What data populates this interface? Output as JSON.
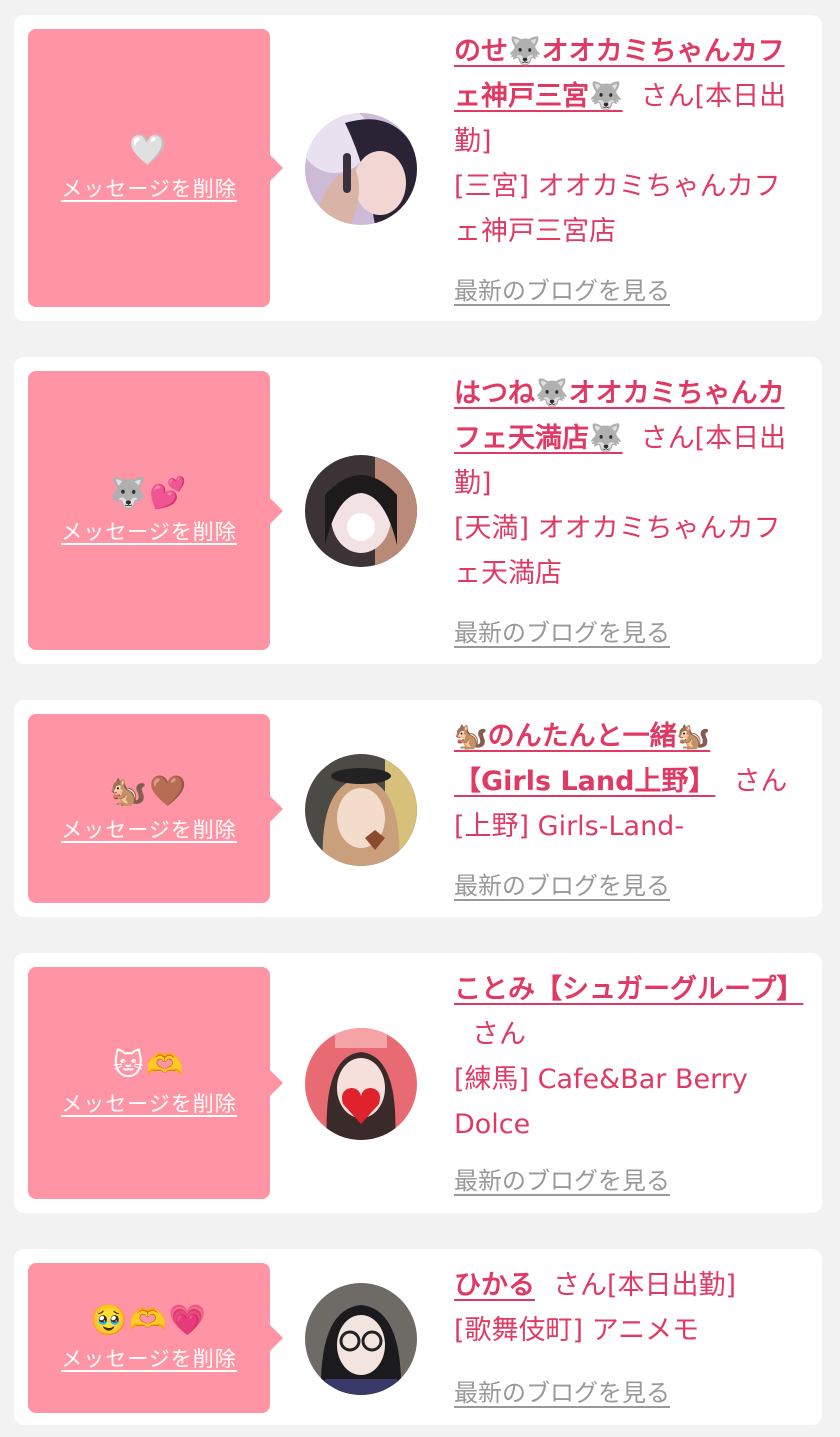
{
  "common": {
    "delete_label": "メッセージを削除",
    "blog_label": "最新のブログを見る",
    "honorific": "さん"
  },
  "colors": {
    "page_background": "#f2f2f2",
    "card_background": "#ffffff",
    "bubble_pink": "#ff94a4",
    "accent_text": "#e03a64",
    "muted_link": "#999999"
  },
  "messages": [
    {
      "stamp": "🤍",
      "cast_name": "のせ🐺オオカミちゃんカフェ神戸三宮🐺",
      "status": "[本日出勤]",
      "shop": "[三宮] オオカミちゃんカフェ神戸三宮店",
      "avatar_icon": "cast-photo"
    },
    {
      "stamp": "🐺💕",
      "cast_name": "はつね🐺オオカミちゃんカフェ天満店🐺",
      "status": "[本日出勤]",
      "shop": "[天満] オオカミちゃんカフェ天満店",
      "avatar_icon": "cast-photo"
    },
    {
      "stamp": "🐿️🤎",
      "cast_name": "🐿️のんたんと一緒🐿️【Girls Land上野】",
      "status": "",
      "shop": "[上野] Girls-Land-",
      "avatar_icon": "cast-photo"
    },
    {
      "stamp": "🐱🫶",
      "cast_name": "ことみ【シュガーグループ】",
      "status": "",
      "shop": "[練馬] Cafe&Bar Berry Dolce",
      "avatar_icon": "cast-photo"
    },
    {
      "stamp": "🥹🫶💗",
      "cast_name": "ひかる",
      "status": "[本日出勤]",
      "shop": "[歌舞伎町] アニメモ",
      "avatar_icon": "cast-photo"
    }
  ]
}
